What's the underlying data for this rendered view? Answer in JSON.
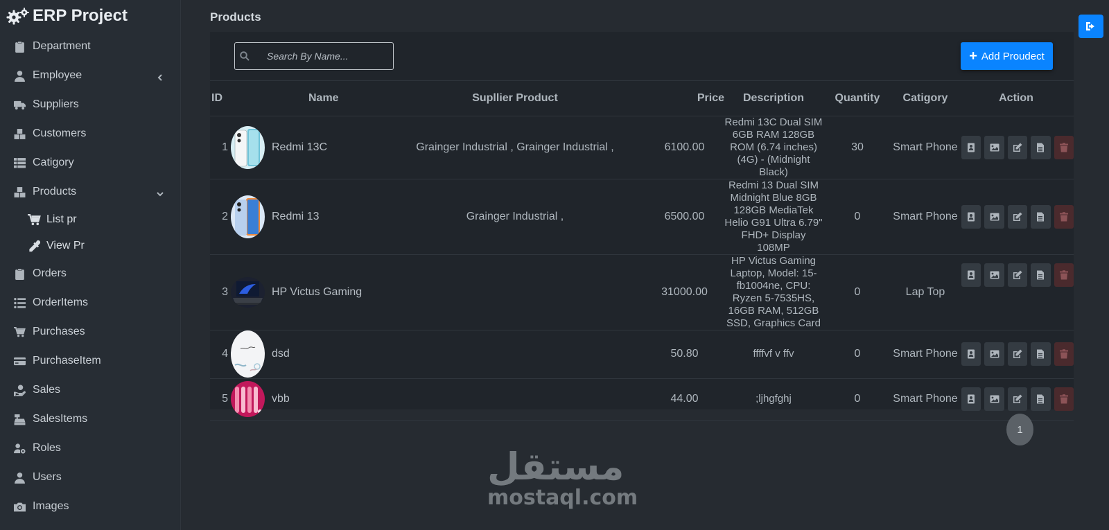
{
  "app": {
    "title": "ERP Project"
  },
  "sidebar": {
    "items": [
      {
        "label": "Department",
        "icon": "clipboard-icon"
      },
      {
        "label": "Employee",
        "icon": "user-icon",
        "chevron": "left"
      },
      {
        "label": "Suppliers",
        "icon": "truck-icon"
      },
      {
        "label": "Customers",
        "icon": "boxes-icon"
      },
      {
        "label": "Catigory",
        "icon": "table-list-icon"
      },
      {
        "label": "Products",
        "icon": "boxes-icon",
        "chevron": "down"
      },
      {
        "label": "Orders",
        "icon": "clipboard-icon"
      },
      {
        "label": "OrderItems",
        "icon": "list-icon"
      },
      {
        "label": "Purchases",
        "icon": "cart-icon"
      },
      {
        "label": "PurchaseItem",
        "icon": "credit-card-icon"
      },
      {
        "label": "Sales",
        "icon": "hand-coin-icon"
      },
      {
        "label": "SalesItems",
        "icon": "cash-register-icon"
      },
      {
        "label": "Roles",
        "icon": "user-gear-icon"
      },
      {
        "label": "Users",
        "icon": "user-icon"
      },
      {
        "label": "Images",
        "icon": "camera-icon"
      }
    ],
    "products_sub": [
      {
        "label": "List pr",
        "icon": "cart-icon"
      },
      {
        "label": "View Pr",
        "icon": "eyedropper-icon"
      }
    ]
  },
  "main": {
    "title": "Products",
    "search_placeholder": "Search By Name...",
    "add_button": "Add Proudect",
    "columns": [
      "ID",
      "Name",
      "Supllier Product",
      "Price",
      "Description",
      "Quantity",
      "Catigory",
      "Action"
    ],
    "rows": [
      {
        "id": "1",
        "name": "Redmi 13C",
        "supplier": "Grainger Industrial , Grainger Industrial ,",
        "price": "6100.00",
        "description": "Redmi 13C Dual SIM 6GB RAM 128GB ROM (6.74 inches) (4G) - (Midnight Black)",
        "quantity": "30",
        "category": "Smart Phone",
        "thumb": "phone-light-blue"
      },
      {
        "id": "2",
        "name": "Redmi 13",
        "supplier": "Grainger Industrial ,",
        "price": "6500.00",
        "description": "Redmi 13 Dual SIM Midnight Blue 8GB 128GB MediaTek Helio G91 Ultra 6.79\" FHD+ Display 108MP",
        "quantity": "0",
        "category": "Smart Phone",
        "thumb": "phone-blue-orange"
      },
      {
        "id": "3",
        "name": "HP Victus Gaming",
        "supplier": "",
        "price": "31000.00",
        "description": "HP Victus Gaming Laptop, Model: 15-fb1004ne, CPU: Ryzen 5-7535HS, 16GB RAM, 512GB SSD, Graphics Card",
        "quantity": "0",
        "category": "Lap Top",
        "thumb": "laptop"
      },
      {
        "id": "4",
        "name": "dsd",
        "supplier": "",
        "price": "50.80",
        "description": "ffffvf v ffv",
        "quantity": "0",
        "category": "Smart Phone",
        "thumb": "white-sketch"
      },
      {
        "id": "5",
        "name": "vbb",
        "supplier": "",
        "price": "44.00",
        "description": ";ljhgfghj",
        "quantity": "0",
        "category": "Smart Phone",
        "thumb": "pink-pattern"
      }
    ],
    "pagination": {
      "current": "1"
    }
  },
  "watermark": {
    "arabic": "مستقل",
    "latin": "mostaql.com"
  },
  "colors": {
    "accent": "#0a84ff",
    "delete": "#4a2a2d",
    "background": "#262b31",
    "panel": "#20252b"
  }
}
